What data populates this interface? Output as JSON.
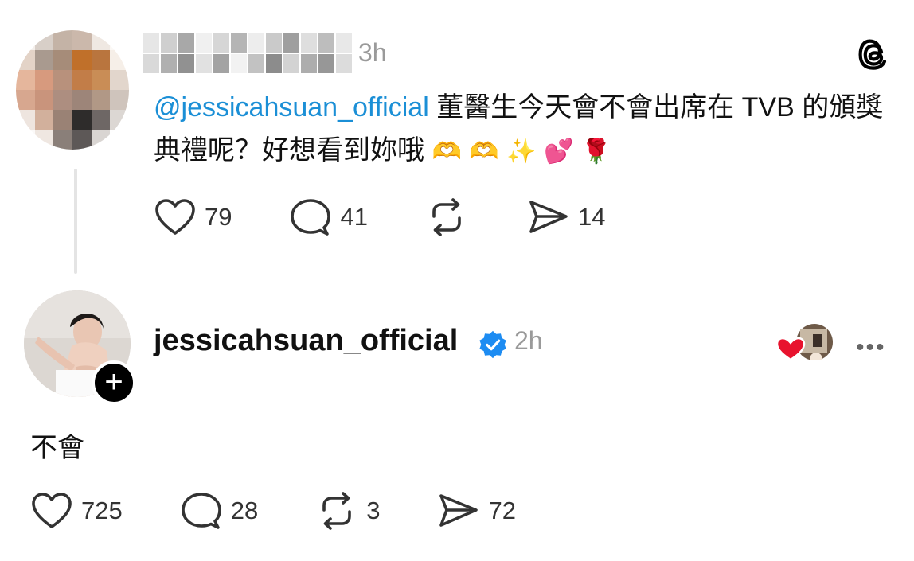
{
  "post": {
    "time": "3h",
    "mention": "@jessicahsuan_official",
    "text": " 董醫生今天會不會出席在 TVB 的頒獎典禮呢？好想看到妳哦",
    "emojis": "🫶 🫶 ✨ 💕 🌹",
    "stats": {
      "likes": "79",
      "replies": "41",
      "shares": "14"
    }
  },
  "reply": {
    "username": "jessicahsuan_official",
    "time": "2h",
    "text": "不會",
    "stats": {
      "likes": "725",
      "replies": "28",
      "reposts": "3",
      "shares": "72"
    }
  },
  "colors": {
    "mention": "#1b8fd6",
    "verified": "#1d8cf2",
    "heart": "#e8132e"
  },
  "icons": [
    "threads-icon",
    "heart-icon",
    "comment-icon",
    "repost-icon",
    "send-icon",
    "verified-icon",
    "follow-plus-icon",
    "more-icon"
  ]
}
